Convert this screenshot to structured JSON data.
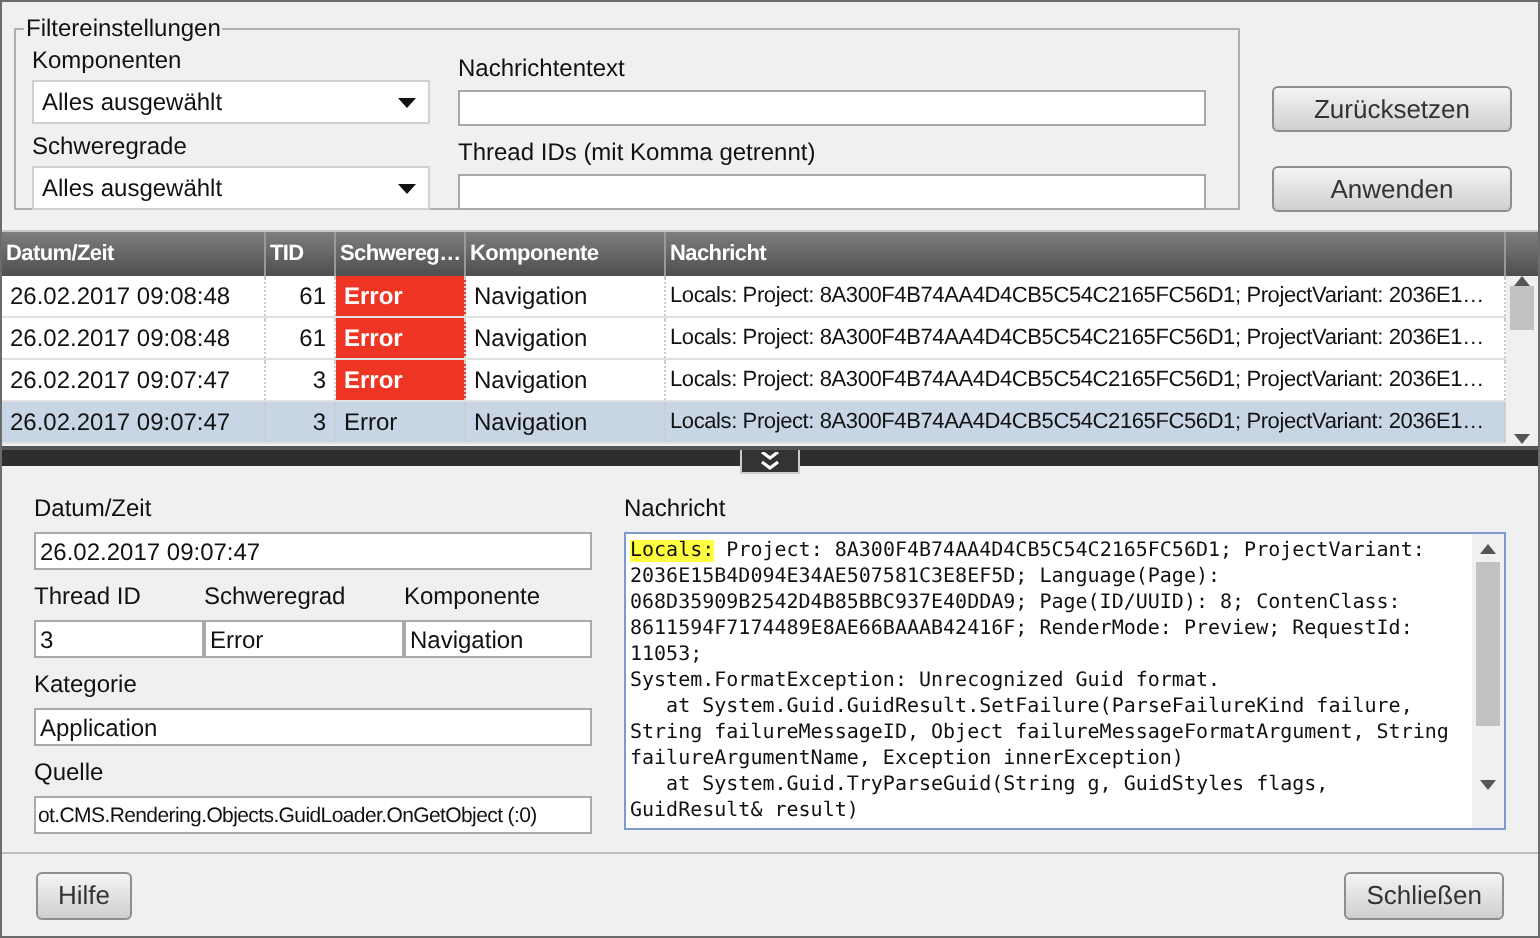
{
  "filter": {
    "title": "Filtereinstellungen",
    "components": {
      "label": "Komponenten",
      "value": "Alles ausgewählt"
    },
    "severities": {
      "label": "Schweregrade",
      "value": "Alles ausgewählt"
    },
    "message_text": {
      "label": "Nachrichtentext"
    },
    "thread_ids": {
      "label": "Thread IDs (mit Komma getrennt)"
    },
    "buttons": [
      "Zurücksetzen",
      "Anwenden"
    ]
  },
  "table": {
    "columns": [
      "Datum/Zeit",
      "TID",
      "Schwereg…",
      "Komponente",
      "Nachricht"
    ],
    "rows": [
      {
        "time": "26.02.2017 09:08:48",
        "tid": "61",
        "severity": "Error",
        "error": true,
        "component": "Navigation",
        "message": "Locals: Project: 8A300F4B74AA4D4CB5C54C2165FC56D1; ProjectVariant: 2036E1…",
        "selected": false
      },
      {
        "time": "26.02.2017 09:08:48",
        "tid": "61",
        "severity": "Error",
        "error": true,
        "component": "Navigation",
        "message": "Locals: Project: 8A300F4B74AA4D4CB5C54C2165FC56D1; ProjectVariant: 2036E1…",
        "selected": false
      },
      {
        "time": "26.02.2017 09:07:47",
        "tid": "3",
        "severity": "Error",
        "error": true,
        "component": "Navigation",
        "message": "Locals: Project: 8A300F4B74AA4D4CB5C54C2165FC56D1; ProjectVariant: 2036E1…",
        "selected": false
      },
      {
        "time": "26.02.2017 09:07:47",
        "tid": "3",
        "severity": "Error",
        "error": false,
        "component": "Navigation",
        "message": "Locals: Project: 8A300F4B74AA4D4CB5C54C2165FC56D1; ProjectVariant: 2036E1…",
        "selected": true
      }
    ]
  },
  "details": {
    "datetime": {
      "label": "Datum/Zeit",
      "value": "26.02.2017 09:07:47"
    },
    "thread_id": {
      "label": "Thread ID",
      "value": "3"
    },
    "severity": {
      "label": "Schweregrad",
      "value": "Error"
    },
    "component": {
      "label": "Komponente",
      "value": "Navigation"
    },
    "category": {
      "label": "Kategorie",
      "value": "Application"
    },
    "source": {
      "label": "Quelle",
      "value": "ot.CMS.Rendering.Objects.GuidLoader.OnGetObject (:0)"
    },
    "message": {
      "label": "Nachricht",
      "lines": [
        [
          {
            "text": "Locals:",
            "highlighted": true
          },
          {
            "text": " Project: 8A300F4B74AA4D4CB5C54C2165FC56D1; ProjectVariant:",
            "highlighted": false
          }
        ],
        [
          {
            "text": "2036E15B4D094E34AE507581C3E8EF5D; Language(Page):",
            "highlighted": false
          }
        ],
        [
          {
            "text": "068D35909B2542D4B85BBC937E40DDA9; Page(ID/UUID): 8; ContenClass:",
            "highlighted": false
          }
        ],
        [
          {
            "text": "8611594F7174489E8AE66BAAAB42416F; RenderMode: Preview; RequestId:",
            "highlighted": false
          }
        ],
        [
          {
            "text": "11053;",
            "highlighted": false
          }
        ],
        [
          {
            "text": "System.FormatException: Unrecognized Guid format.",
            "highlighted": false
          }
        ],
        [
          {
            "text": "   at System.Guid.GuidResult.SetFailure(ParseFailureKind failure,",
            "highlighted": false
          }
        ],
        [
          {
            "text": "String failureMessageID, Object failureMessageFormatArgument, String",
            "highlighted": false
          }
        ],
        [
          {
            "text": "failureArgumentName, Exception innerException)",
            "highlighted": false
          }
        ],
        [
          {
            "text": "   at System.Guid.TryParseGuid(String g, GuidStyles flags,",
            "highlighted": false
          }
        ],
        [
          {
            "text": "GuidResult& result)",
            "highlighted": false
          }
        ]
      ]
    }
  },
  "footer": {
    "help": "Hilfe",
    "close": "Schließen"
  }
}
